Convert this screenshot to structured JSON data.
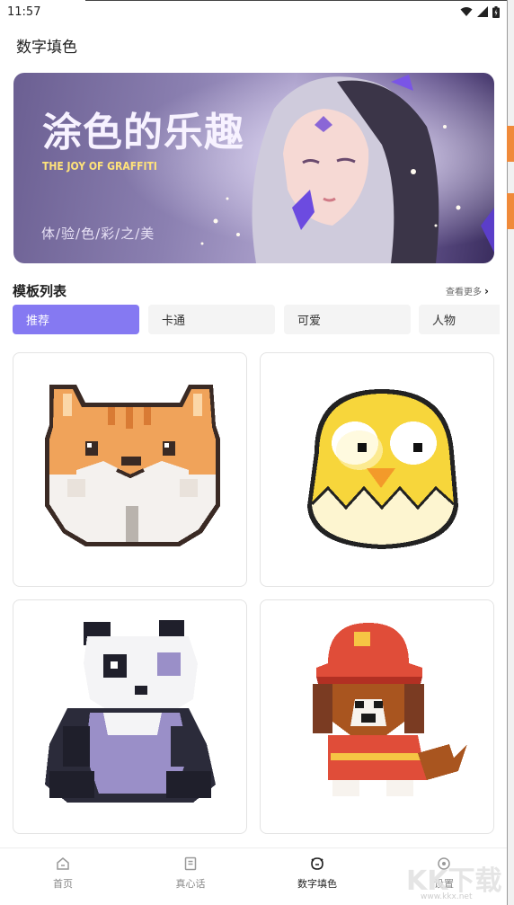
{
  "status_bar": {
    "time": "11:57"
  },
  "header": {
    "title": "数字填色"
  },
  "banner": {
    "title": "涂色的乐趣",
    "subtitle": "THE JOY OF GRAFFITI",
    "tagline": "体/验/色/彩/之/美"
  },
  "section": {
    "title": "模板列表",
    "see_more": "查看更多"
  },
  "tabs": [
    {
      "label": "推荐",
      "active": true
    },
    {
      "label": "卡通",
      "active": false
    },
    {
      "label": "可爱",
      "active": false
    },
    {
      "label": "人物",
      "active": false
    }
  ],
  "templates": [
    {
      "name": "fox",
      "color": "#f0a35a"
    },
    {
      "name": "chick",
      "color": "#f7d63b"
    },
    {
      "name": "panda",
      "color": "#9a8fc8"
    },
    {
      "name": "firefighter-dog",
      "color": "#e04d39"
    }
  ],
  "bottom_nav": [
    {
      "label": "首页",
      "icon": "home-icon",
      "active": false
    },
    {
      "label": "真心话",
      "icon": "document-icon",
      "active": false
    },
    {
      "label": "数字填色",
      "icon": "palette-icon",
      "active": true
    },
    {
      "label": "设置",
      "icon": "settings-icon",
      "active": false
    }
  ],
  "watermark": {
    "text": "KK下载",
    "url": "www.kkx.net"
  },
  "colors": {
    "accent": "#8579f2",
    "tab_bg": "#f4f4f4"
  }
}
